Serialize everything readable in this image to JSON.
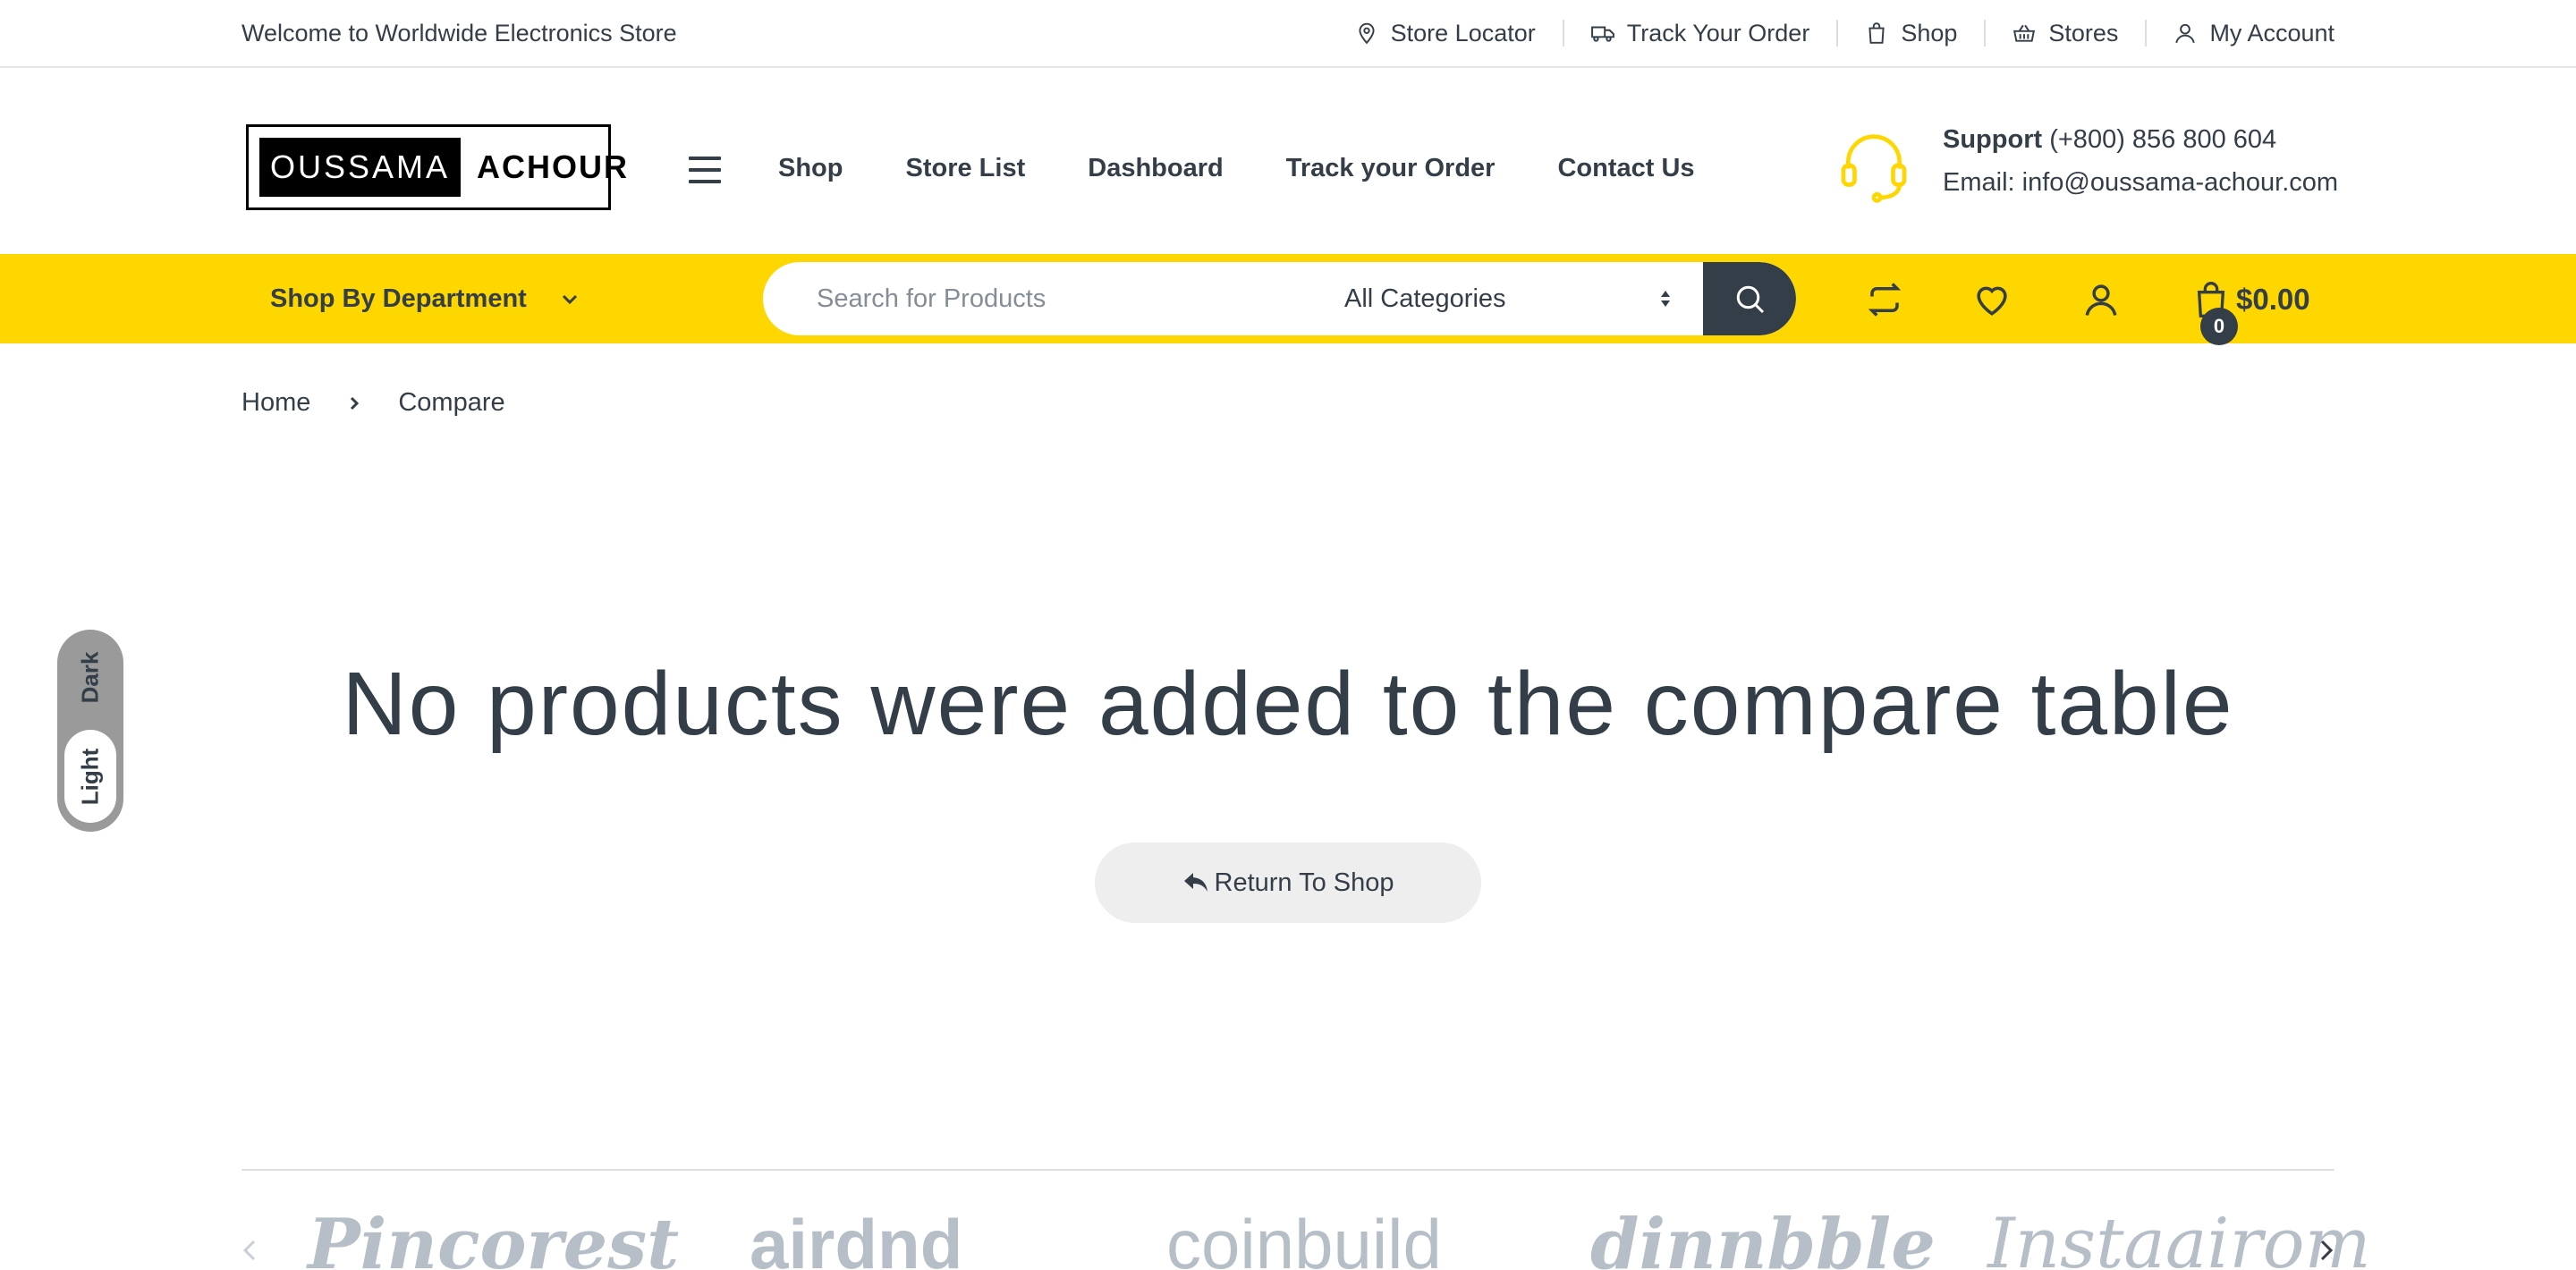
{
  "topbar": {
    "welcome": "Welcome to Worldwide Electronics Store",
    "links": [
      {
        "label": "Store Locator",
        "icon": "map-pin-icon"
      },
      {
        "label": "Track Your Order",
        "icon": "truck-icon"
      },
      {
        "label": "Shop",
        "icon": "shopping-bag-icon"
      },
      {
        "label": "Stores",
        "icon": "basket-icon"
      },
      {
        "label": "My Account",
        "icon": "user-icon"
      }
    ]
  },
  "header": {
    "logo": {
      "part1": "OUSSAMA",
      "part2": "ACHOUR"
    },
    "nav": [
      "Shop",
      "Store List",
      "Dashboard",
      "Track your Order",
      "Contact Us"
    ],
    "support": {
      "label": "Support",
      "phone": "(+800) 856 800 604",
      "email": "Email: info@oussama-achour.com"
    }
  },
  "bar": {
    "department": "Shop By Department",
    "search_placeholder": "Search for Products",
    "category": "All Categories",
    "cart_count": "0",
    "cart_total": "$0.00"
  },
  "breadcrumb": {
    "home": "Home",
    "current": "Compare"
  },
  "mode_toggle": {
    "dark": "Dark",
    "light": "Light",
    "active": "Light"
  },
  "main": {
    "message": "No products were added to the compare table",
    "return_button": "Return To Shop"
  },
  "brands": [
    "Pincorest",
    "airdnd",
    "coinbuild",
    "dinnbble",
    "Instaairom"
  ],
  "colors": {
    "accent": "#fed700",
    "text": "#333e48",
    "brand_logo": "#b6bec8",
    "button_bg": "#eeeeee"
  }
}
